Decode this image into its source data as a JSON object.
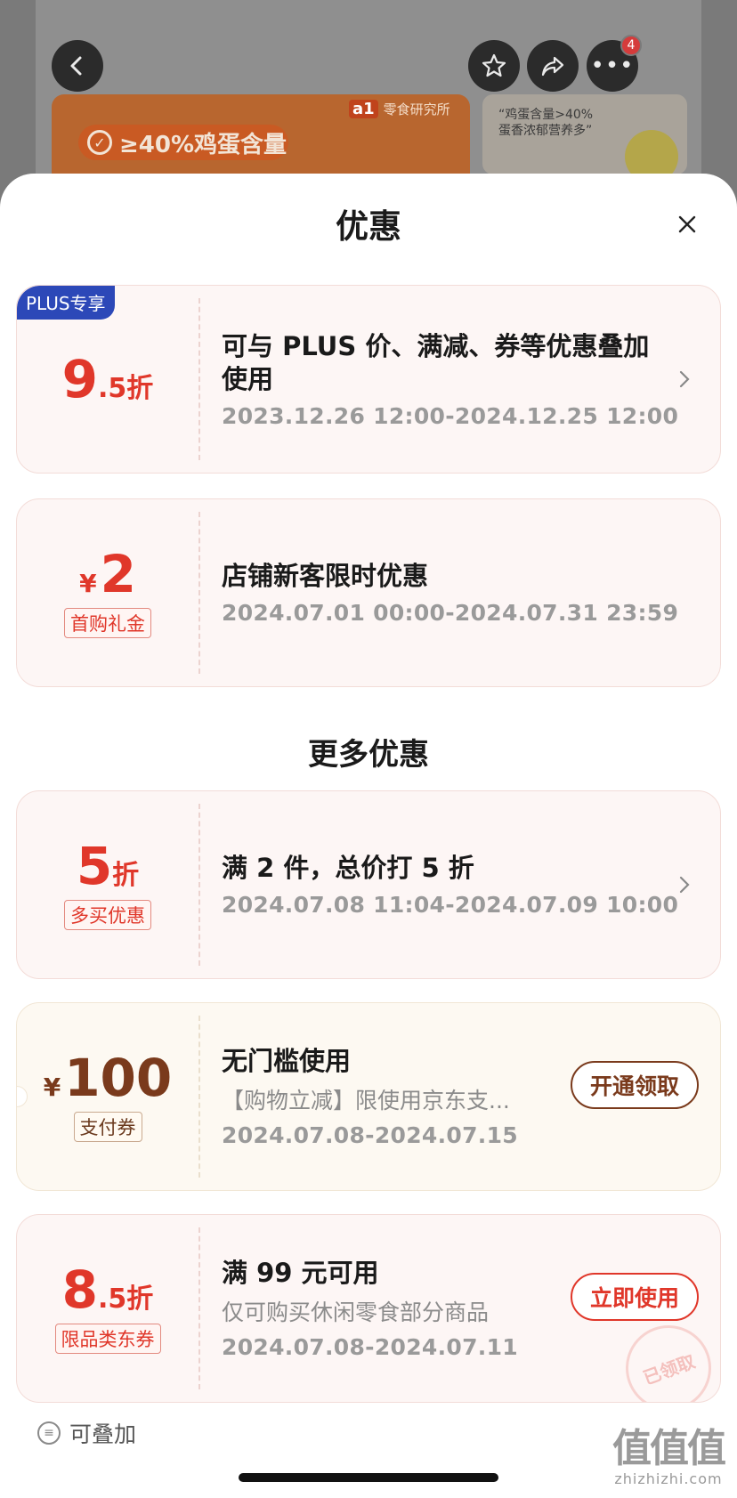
{
  "background": {
    "banner_badge_text": "≥40%鸡蛋含量",
    "brand_logo_mark": "a1",
    "brand_logo_text": "零食研究所",
    "right_card_line1": "“鸡蛋含量>40%",
    "right_card_line2": "蛋香浓郁营养多”",
    "notification_count": "4"
  },
  "sheet": {
    "title": "优惠",
    "more_title": "更多优惠",
    "stack_label": "可叠加"
  },
  "coupons": [
    {
      "badge": "PLUS专享",
      "amount_big": "9",
      "amount_small": ".5折",
      "title": "可与 PLUS 价、满减、券等优惠叠加使用",
      "date": "2023.12.26 12:00-2024.12.25 12:00"
    },
    {
      "currency": "¥",
      "amount_big": "2",
      "tag": "首购礼金",
      "title": "店铺新客限时优惠",
      "date": "2024.07.01 00:00-2024.07.31 23:59"
    },
    {
      "amount_big": "5",
      "amount_small": "折",
      "tag": "多买优惠",
      "title": "满 2 件，总价打 5 折",
      "date": "2024.07.08 11:04-2024.07.09 10:00"
    },
    {
      "currency": "¥",
      "amount_big": "100",
      "tag": "支付券",
      "title": "无门槛使用",
      "desc": "【购物立减】限使用京东支...",
      "date": "2024.07.08-2024.07.15",
      "button": "开通领取"
    },
    {
      "amount_big": "8",
      "amount_small": ".5折",
      "tag": "限品类东券",
      "title": "满 99 元可用",
      "desc": "仅可购买休闲零食部分商品",
      "date": "2024.07.08-2024.07.11",
      "button": "立即使用",
      "stamp": "已领取"
    }
  ],
  "watermark": {
    "main": "值值值",
    "sub": "zhizhizhi.com"
  },
  "icons": [
    "back-icon",
    "star-icon",
    "share-icon",
    "more-icon",
    "close-icon",
    "chevron-right-icon",
    "stack-icon"
  ]
}
